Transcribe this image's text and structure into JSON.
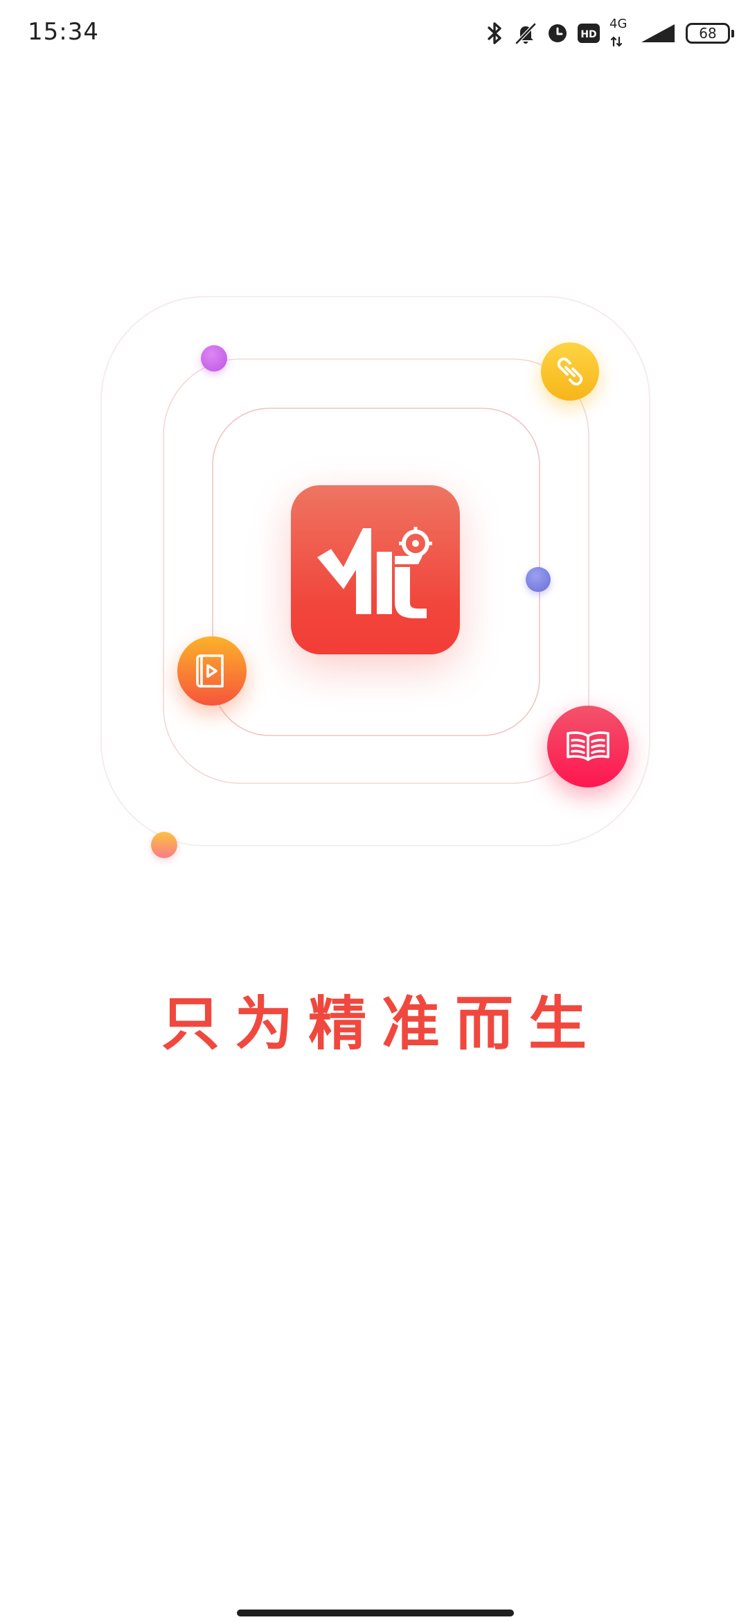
{
  "status_bar": {
    "time": "15:34",
    "network_type": "4G",
    "battery_level": "68",
    "icons": [
      "bluetooth-icon",
      "mute-icon",
      "alarm-icon",
      "hd-icon",
      "signal-icon",
      "battery-icon"
    ]
  },
  "illustration": {
    "logo_icon": "you-logo-icon",
    "badges": [
      "link-icon",
      "video-icon",
      "book-icon"
    ],
    "colors": {
      "logo_top": "#ee7562",
      "logo_bottom": "#f33d38",
      "link_badge": "#f7b51a",
      "video_badge": "#f6553b",
      "book_badge": "#fe1650",
      "dot_purple": "#bb56e3",
      "dot_blue": "#6a6fd6",
      "dot_orange": "#f77c86"
    }
  },
  "slogan": "只为精准而生"
}
